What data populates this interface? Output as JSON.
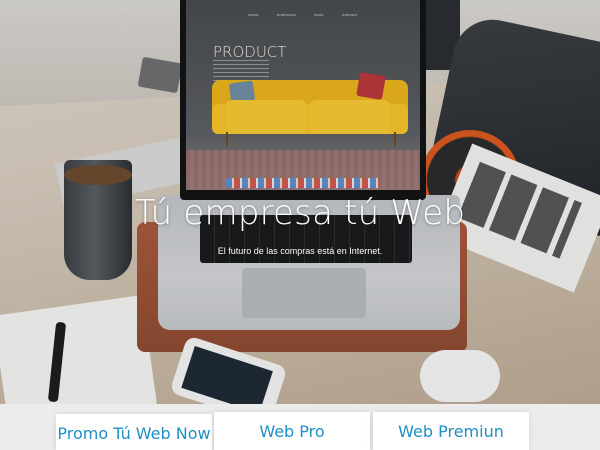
{
  "hero": {
    "headline": "Tú empresa tú Web",
    "subheadline": "El futuro de las compras está en Internet."
  },
  "screen": {
    "nav": [
      "INICIO",
      "PORTFOLIO",
      "BLOG",
      "CONTACT"
    ],
    "title": "PRODUCT"
  },
  "plans": [
    {
      "label": "Promo Tú Web Now"
    },
    {
      "label": "Web Pro"
    },
    {
      "label": "Web Premiun"
    }
  ],
  "colors": {
    "plan_text": "#1f8fc5",
    "headline": "#ffffff"
  }
}
